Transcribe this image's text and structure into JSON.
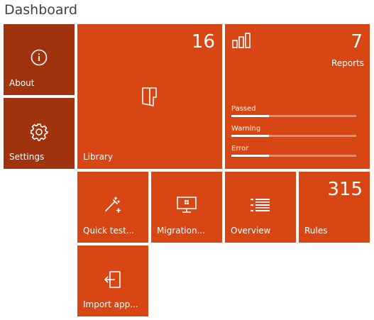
{
  "page": {
    "title": "Dashboard"
  },
  "tiles": {
    "about": {
      "label": "About",
      "icon": "info-icon"
    },
    "settings": {
      "label": "Settings",
      "icon": "gear-icon"
    },
    "library": {
      "label": "Library",
      "count": "16",
      "icon": "book-icon"
    },
    "reports": {
      "label": "Reports",
      "count": "7",
      "icon": "bar-chart-icon",
      "bars": [
        {
          "label": "Passed",
          "fill": 0.3
        },
        {
          "label": "Warning",
          "fill": 0.3
        },
        {
          "label": "Error",
          "fill": 0.3
        }
      ]
    },
    "quicktest": {
      "label": "Quick test...",
      "icon": "magic-wand-icon"
    },
    "migration": {
      "label": "Migration...",
      "icon": "monitor-windows-icon"
    },
    "overview": {
      "label": "Overview",
      "icon": "list-icon"
    },
    "rules": {
      "label": "Rules",
      "count": "315"
    },
    "import": {
      "label": "Import app...",
      "icon": "import-icon"
    }
  },
  "colors": {
    "tile": "#d84713",
    "tile_dark": "#a0330d",
    "bar_track": "#e88a66"
  }
}
